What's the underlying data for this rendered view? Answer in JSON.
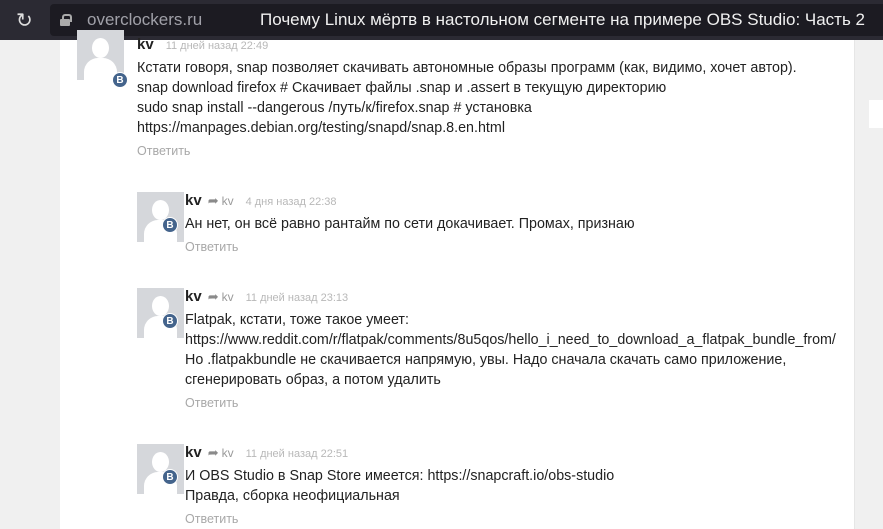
{
  "browser": {
    "domain": "overclockers.ru",
    "title": "Почему Linux мёртв в настольном сегменте на примере OBS Studio: Часть 2"
  },
  "comments": [
    {
      "author": "kv",
      "reply_to": null,
      "time": "11 дней назад 22:49",
      "badge": "B",
      "lines": [
        "Кстати говоря, snap позволяет скачивать автономные образы программ (как, видимо, хочет автор).",
        "snap download firefox  # Скачивает файлы .snap и .assert в текущую директорию",
        "sudo snap install --dangerous /путь/к/firefox.snap # установка",
        "https://manpages.debian.org/testing/snapd/snap.8.en.html"
      ],
      "reply_label": "Ответить"
    },
    {
      "author": "kv",
      "reply_to": "kv",
      "time": "4 дня назад 22:38",
      "badge": "B",
      "lines": [
        "Ан нет, он всё равно рантайм по сети докачивает. Промах, признаю"
      ],
      "reply_label": "Ответить"
    },
    {
      "author": "kv",
      "reply_to": "kv",
      "time": "11 дней назад 23:13",
      "badge": "B",
      "lines": [
        "Flatpak, кстати, тоже такое умеет:",
        "https://www.reddit.com/r/flatpak/comments/8u5qos/hello_i_need_to_download_a_flatpak_bundle_from/",
        "Но .flatpakbundle не скачивается напрямую, увы. Надо сначала скачать само приложение,",
        "сгенерировать образ, а потом удалить"
      ],
      "reply_label": "Ответить"
    },
    {
      "author": "kv",
      "reply_to": "kv",
      "time": "11 дней назад 22:51",
      "badge": "B",
      "lines": [
        "И OBS Studio в Snap Store имеется: https://snapcraft.io/obs-studio",
        "Правда, сборка неофициальная"
      ],
      "reply_label": "Ответить"
    }
  ]
}
